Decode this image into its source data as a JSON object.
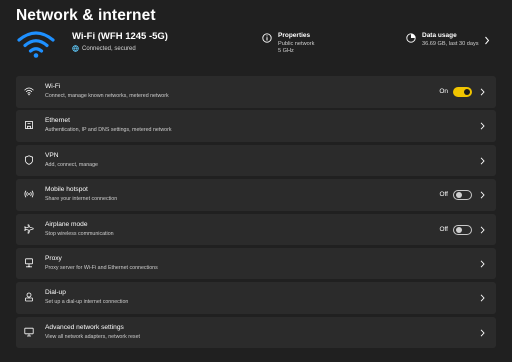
{
  "page": {
    "title": "Network & internet"
  },
  "hero": {
    "network_name": "Wi-Fi (WFH 1245 -5G)",
    "status": "Connected, secured",
    "properties": {
      "title": "Properties",
      "line1": "Public network",
      "line2": "5 GHz"
    },
    "data_usage": {
      "title": "Data usage",
      "detail": "36.69 GB, last 30 days"
    }
  },
  "colors": {
    "accent": "#f0c400",
    "background": "#202020",
    "card": "#2b2b2b",
    "status_ok": "#60cdff"
  },
  "items": [
    {
      "key": "wifi",
      "icon": "wifi-icon",
      "title": "Wi-Fi",
      "desc": "Connect, manage known networks, metered network",
      "toggle": "On"
    },
    {
      "key": "ethernet",
      "icon": "ethernet-icon",
      "title": "Ethernet",
      "desc": "Authentication, IP and DNS settings, metered network"
    },
    {
      "key": "vpn",
      "icon": "shield-icon",
      "title": "VPN",
      "desc": "Add, connect, manage"
    },
    {
      "key": "hotspot",
      "icon": "hotspot-icon",
      "title": "Mobile hotspot",
      "desc": "Share your internet connection",
      "toggle": "Off"
    },
    {
      "key": "airplane",
      "icon": "airplane-icon",
      "title": "Airplane mode",
      "desc": "Stop wireless communication",
      "toggle": "Off"
    },
    {
      "key": "proxy",
      "icon": "proxy-icon",
      "title": "Proxy",
      "desc": "Proxy server for Wi-Fi and Ethernet connections"
    },
    {
      "key": "dialup",
      "icon": "dialup-icon",
      "title": "Dial-up",
      "desc": "Set up a dial-up internet connection"
    },
    {
      "key": "advanced",
      "icon": "monitor-icon",
      "title": "Advanced network settings",
      "desc": "View all network adapters, network reset"
    }
  ]
}
